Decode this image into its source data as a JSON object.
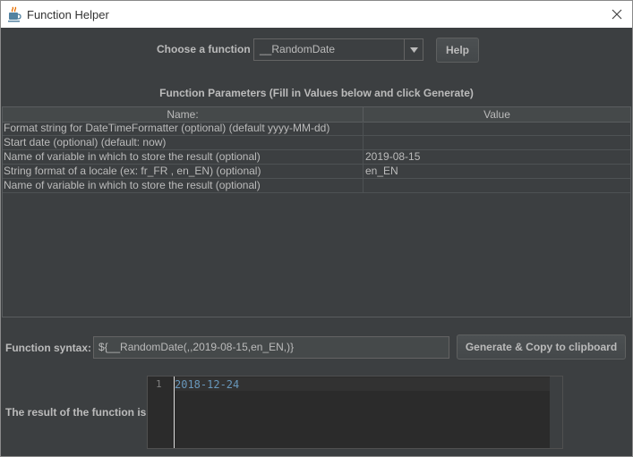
{
  "window": {
    "title": "Function Helper"
  },
  "chooser": {
    "label": "Choose a function",
    "selected_function": "__RandomDate",
    "help_label": "Help"
  },
  "params": {
    "title": "Function Parameters (Fill in Values below and click Generate)",
    "columns": [
      "Name:",
      "Value"
    ],
    "rows": [
      {
        "name": "Format string for DateTimeFormatter (optional) (default yyyy-MM-dd)",
        "value": ""
      },
      {
        "name": "Start date (optional) (default: now)",
        "value": ""
      },
      {
        "name": "Name of variable in which to store the result (optional)",
        "value": "2019-08-15"
      },
      {
        "name": "String format of a locale (ex: fr_FR , en_EN) (optional)",
        "value": "en_EN"
      },
      {
        "name": "Name of variable in which to store the result (optional)",
        "value": ""
      }
    ]
  },
  "syntax": {
    "label": "Function syntax:",
    "value": "${__RandomDate(,,2019-08-15,en_EN,)}",
    "generate_label": "Generate & Copy to clipboard"
  },
  "result": {
    "label": "The result of the function is",
    "line_number": "1",
    "value": "2018-12-24"
  },
  "colors": {
    "background": "#3c3f41",
    "text": "#bbbbbb",
    "editor_bg": "#2b2b2b",
    "code_number": "#6897bb"
  }
}
